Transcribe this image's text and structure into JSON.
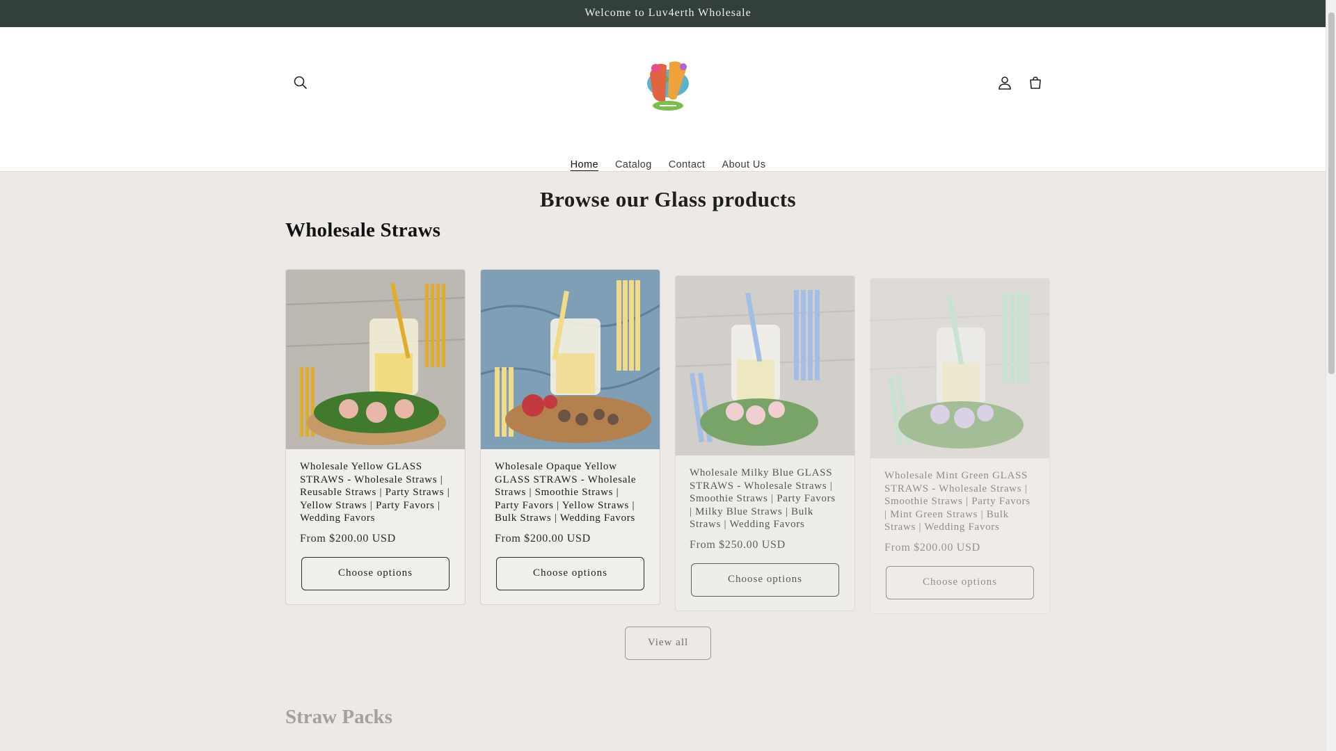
{
  "announcement": {
    "text": "Welcome to Luv4erth Wholesale"
  },
  "header": {
    "search_icon": "search-icon",
    "account_icon": "account-icon",
    "cart_icon": "cart-icon",
    "nav": [
      {
        "label": "Home",
        "active": true
      },
      {
        "label": "Catalog",
        "active": false
      },
      {
        "label": "Contact",
        "active": false
      },
      {
        "label": "About Us",
        "active": false
      }
    ]
  },
  "main": {
    "browse_title": "Browse our Glass products",
    "section_title": "Wholesale Straws",
    "products": [
      {
        "title": "Wholesale Yellow GLASS STRAWS - Wholesale Straws | Reusable Straws | Party Straws | Yellow Straws | Party Favors | Wedding Favors",
        "price": "From $200.00 USD",
        "button": "Choose options",
        "bg": "#b9b4ad",
        "straw_color": "#e1ac2c",
        "flower_color": "#e9b6aa"
      },
      {
        "title": "Wholesale Opaque Yellow GLASS STRAWS - Wholesale Straws | Smoothie Straws | Party Favors | Yellow Straws | Bulk Straws | Wedding Favors",
        "price": "From $200.00 USD",
        "button": "Choose options",
        "bg": "#7d9db5",
        "straw_color": "#f1db88",
        "flower_color": "#c23a3f"
      },
      {
        "title": "Wholesale Milky Blue GLASS STRAWS - Wholesale Straws | Smoothie Straws | Party Favors | Milky Blue Straws | Bulk Straws | Wedding Favors",
        "price": "From $250.00 USD",
        "button": "Choose options",
        "bg": "#c7c3bd",
        "straw_color": "#86aee8",
        "flower_color": "#f2c4cb"
      },
      {
        "title": "Wholesale Mint Green GLASS STRAWS - Wholesale Straws | Smoothie Straws | Party Favors | Mint Green Straws | Bulk Straws | Wedding Favors",
        "price": "From $200.00 USD",
        "button": "Choose options",
        "bg": "#cdc9c2",
        "straw_color": "#9fdcb8",
        "flower_color": "#c6b5e6"
      }
    ],
    "view_all": "View all",
    "next_section_title": "Straw Packs"
  }
}
